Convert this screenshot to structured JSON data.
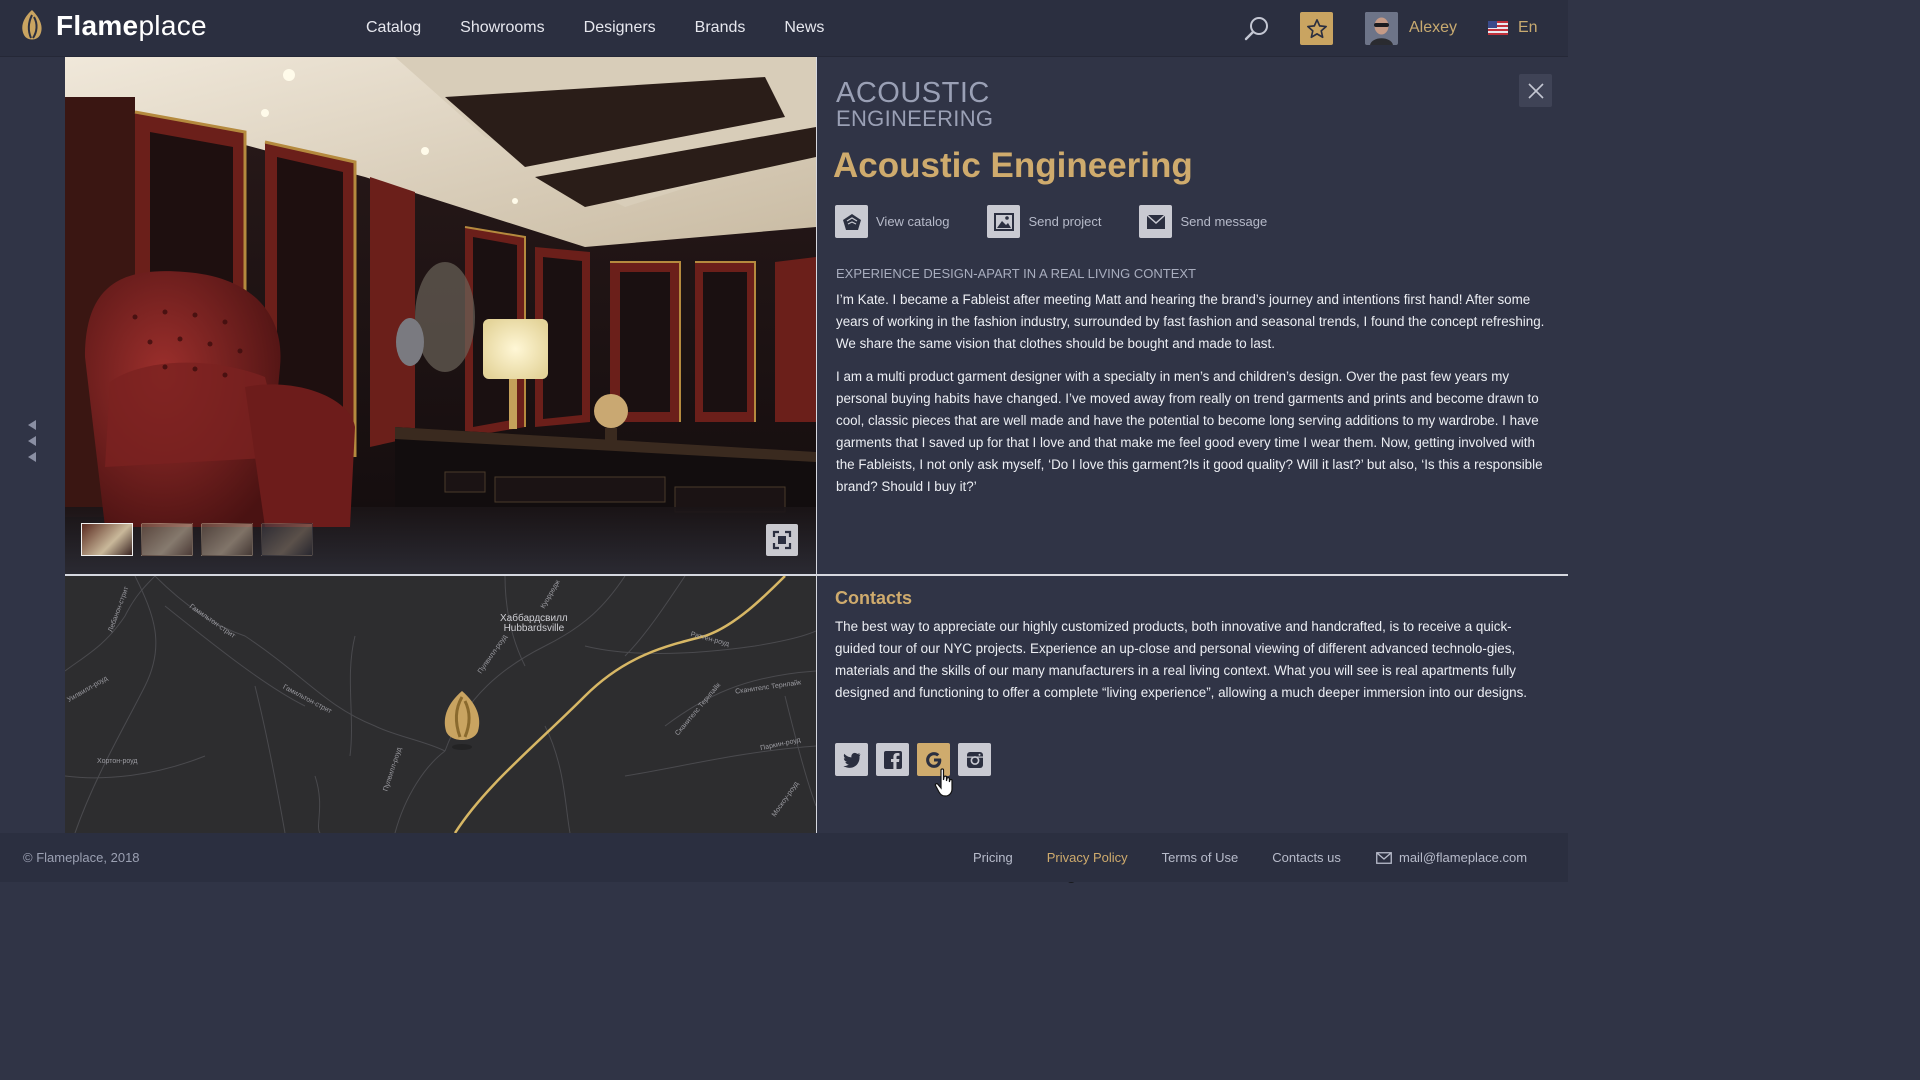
{
  "header": {
    "logo_bold": "Flame",
    "logo_light": "place",
    "nav": [
      "Catalog",
      "Showrooms",
      "Designers",
      "Brands",
      "News"
    ],
    "user_name": "Alexey",
    "language": "En"
  },
  "gallery": {
    "thumbnail_count": 4,
    "active_thumbnail": 1
  },
  "brand": {
    "logo_line1": "ACOUSTIC",
    "logo_line2": "ENGINEERING",
    "title": "Acoustic Engineering",
    "actions": {
      "view_catalog": "View catalog",
      "send_project": "Send project",
      "send_message": "Send message"
    },
    "subheading": "EXPERIENCE DESIGN-APART IN A REAL LIVING CONTEXT",
    "paragraph1": "I’m Kate. I became a Fableist after meeting Matt and hearing the brand’s journey and intentions first hand! After some years of working in the fashion industry, surrounded by fast fashion and seasonal trends, I found the concept refreshing. We share the same vision that clothes should be bought and made to last.",
    "paragraph2": "I am a multi product garment designer with a specialty in men’s and children’s design. Over the past few years my personal buying habits have changed. I’ve moved away from really on trend garments and prints and become drawn to cool, classic pieces that are well made and have the potential to become long serving additions to my wardrobe. I have garments that I saved up for that I love and that make me feel good every time I wear them. Now, getting involved with the Fableists, I not only ask myself, ‘Do I love this garment?Is it good quality? Will it last?’ but also, ‘Is this a responsible brand? Should I buy it?’"
  },
  "map": {
    "labels": {
      "hubbardsville_ru": "Хаббардсвилл",
      "hubbardsville_en": "Hubbardsville",
      "hamilton1": "Гамильтон-стрит",
      "hamilton2": "Гамильтон-стрит",
      "lebanon": "Лебанон-стрит",
      "pulvill1": "Пулвилл-роуд",
      "pulvill2": "Пулвилл-роуд",
      "horton": "Хортон-роуд",
      "ratten": "Раттен-роуд",
      "skaneateles1": "Сканителс Тернпайк",
      "skaneateles2": "Сканителс Тернпайк",
      "parkin": "Паркин-роуд",
      "moscow": "Москоу-роуд",
      "kuyrugli": "Куорредж",
      "wilville": "Уилвилл-роуд"
    }
  },
  "contacts": {
    "title": "Contacts",
    "text": "The best way to appreciate our highly customized products, both innovative and handcrafted, is to receive a quick-guided tour of our NYC projects. Experience an up-close and personal viewing of different advanced technolo-gies, materials and the skills of our many manufacturers in a real living context. What you will see is real apartments fully designed and functioning to offer a complete “living experience”, allowing a much deeper immersion into our designs."
  },
  "footer": {
    "copyright": "© Flameplace, 2018",
    "links": [
      "Pricing",
      "Privacy Policy",
      "Terms of Use",
      "Contacts us"
    ],
    "email": "mail@flameplace.com"
  },
  "colors": {
    "accent_gold": "#cfab6d",
    "background": "#303446",
    "header": "#2b2f40"
  }
}
